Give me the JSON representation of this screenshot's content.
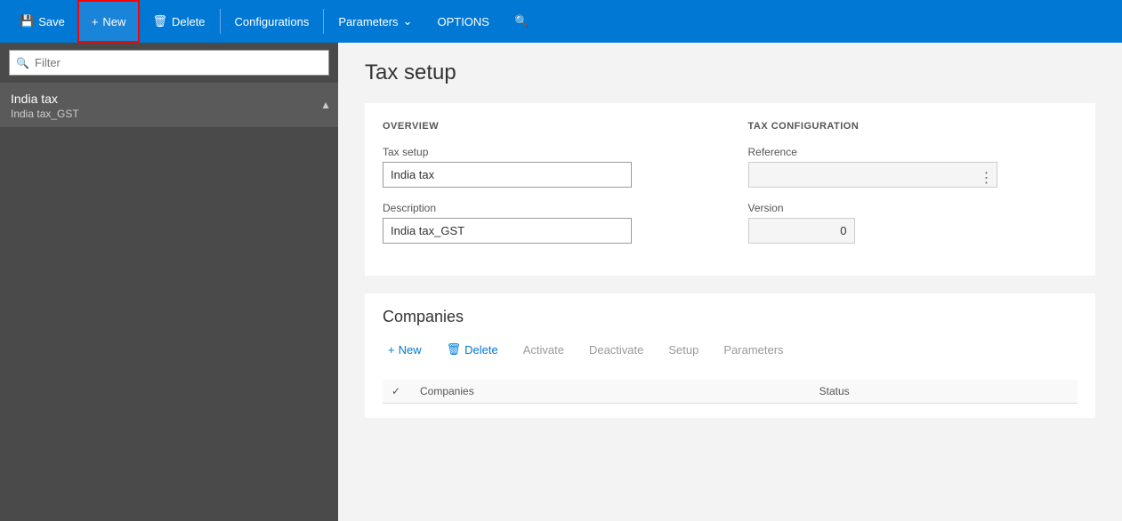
{
  "toolbar": {
    "save_label": "Save",
    "new_label": "New",
    "delete_label": "Delete",
    "configurations_label": "Configurations",
    "parameters_label": "Parameters",
    "options_label": "OPTIONS"
  },
  "sidebar": {
    "filter_placeholder": "Filter",
    "item_title": "India tax",
    "item_sub": "India tax_GST"
  },
  "content": {
    "page_title": "Tax setup",
    "overview_header": "OVERVIEW",
    "tax_config_header": "TAX CONFIGURATION",
    "tax_setup_label": "Tax setup",
    "tax_setup_value": "India tax",
    "description_label": "Description",
    "description_value": "India tax_GST",
    "reference_label": "Reference",
    "reference_value": "",
    "version_label": "Version",
    "version_value": "0",
    "companies_title": "Companies",
    "companies_toolbar": {
      "new_label": "New",
      "delete_label": "Delete",
      "activate_label": "Activate",
      "deactivate_label": "Deactivate",
      "setup_label": "Setup",
      "parameters_label": "Parameters"
    },
    "companies_table": {
      "check_header": "",
      "companies_header": "Companies",
      "status_header": "Status"
    }
  }
}
